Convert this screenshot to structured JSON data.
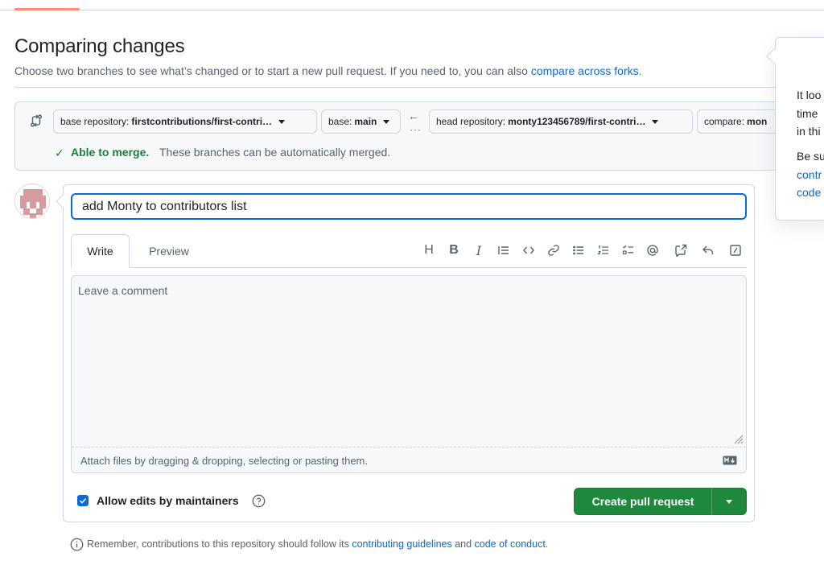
{
  "header": {
    "title": "Comparing changes",
    "description_prefix": "Choose two branches to see what’s changed or to start a new pull request. If you need to, you can also ",
    "compare_forks_link": "compare across forks",
    "description_suffix": "."
  },
  "range": {
    "base_repo_key": "base repository:",
    "base_repo_value": "firstcontributions/first-contri…",
    "base_key": "base:",
    "base_value": "main",
    "swap_arrow": "←",
    "swap_dots": "···",
    "head_repo_key": "head repository:",
    "head_repo_value": "monty123456789/first-contri…",
    "compare_key": "compare:",
    "compare_value": "mon",
    "merge_check": "✓",
    "merge_status": "Able to merge.",
    "merge_note": "These branches can be automatically merged."
  },
  "popover": {
    "line1": "It loo",
    "line2": "time",
    "line3": "in thi",
    "line4": "Be su",
    "link1": "contr",
    "link2": "code"
  },
  "form": {
    "title_value": "add Monty to contributors list",
    "tabs": {
      "write": "Write",
      "preview": "Preview"
    },
    "toolbar": {
      "heading": "H",
      "bold": "B",
      "italic": "I"
    },
    "comment_placeholder": "Leave a comment",
    "attach_text": "Attach files by dragging & dropping, selecting or pasting them.",
    "allow_edits_label": "Allow edits by maintainers",
    "allow_edits_checked": true,
    "create_button": "Create pull request"
  },
  "footer": {
    "remember_prefix": "Remember, contributions to this repository should follow its ",
    "guidelines_link": "contributing guidelines",
    "and_text": " and ",
    "conduct_link": "code of conduct",
    "suffix": "."
  },
  "colors": {
    "accent_blue": "#0969da",
    "success_green": "#1a7f37",
    "button_green": "#1f883d",
    "tab_accent": "#fd8c73",
    "avatar_pink": "#d69a9f"
  },
  "icons": [
    "git-compare-icon",
    "arrow-left-icon",
    "check-icon",
    "heading-icon",
    "bold-icon",
    "italic-icon",
    "quote-icon",
    "code-icon",
    "link-icon",
    "unordered-list-icon",
    "ordered-list-icon",
    "task-list-icon",
    "mention-icon",
    "cross-reference-icon",
    "reply-icon",
    "slash-command-icon",
    "markdown-icon",
    "question-icon",
    "info-icon",
    "resize-grip-icon"
  ]
}
